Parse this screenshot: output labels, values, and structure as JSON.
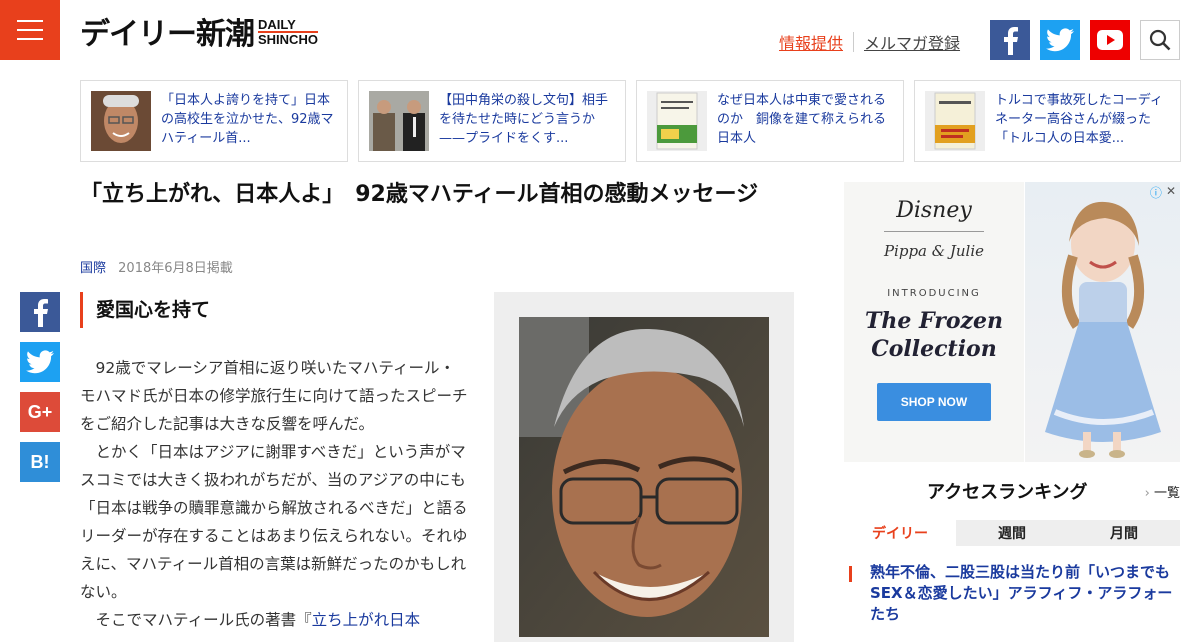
{
  "header": {
    "logo_jp": "デイリー新潮",
    "logo_en_1": "DAILY",
    "logo_en_2": "SHINCHO",
    "link_info": "情報提供",
    "link_mail": "メルマガ登録",
    "accent": "#e8401c"
  },
  "related": [
    {
      "text": "「日本人よ誇りを持て」日本の高校生を泣かせた、92歳マハティール首..."
    },
    {
      "text": "【田中角栄の殺し文句】相手を待たせた時にどう言うか——プライドをくす..."
    },
    {
      "text": "なぜ日本人は中東で愛されるのか　銅像を建て称えられる日本人"
    },
    {
      "text": "トルコで事故死したコーディネーター高谷さんが綴った「トルコ人の日本愛..."
    }
  ],
  "article": {
    "title": "「立ち上がれ、日本人よ」　92歳マハティール首相の感動メッセージ",
    "category": "国際",
    "date": "2018年6月8日掲載",
    "subheading": "愛国心を持て",
    "para1": "92歳でマレーシア首相に返り咲いたマハティール・モハマド氏が日本の修学旅行生に向けて語ったスピーチをご紹介した記事は大きな反響を呼んだ。",
    "para2": "とかく「日本はアジアに謝罪すべきだ」という声がマスコミでは大きく扱われがちだが、当のアジアの中にも「日本は戦争の贖罪意識から解放されるべきだ」と語るリーダーが存在することはあまり伝えられない。それゆえに、マハティール首相の言葉は新鮮だったのかもしれない。",
    "para3_pre": "そこでマハティール氏の著書『",
    "para3_link": "立ち上がれ日本"
  },
  "share": {
    "gplus": "G+",
    "hatena": "B!"
  },
  "ad": {
    "brand": "Disney",
    "sub_brand": "Pippa & Julie",
    "intro": "INTRODUCING",
    "line1": "The Frozen",
    "line2": "Collection",
    "cta": "SHOP NOW",
    "info_icon": "ⓘ",
    "close_icon": "✕"
  },
  "ranking": {
    "title": "アクセスランキング",
    "all_link": "一覧",
    "tabs": [
      "デイリー",
      "週間",
      "月間"
    ],
    "active_tab": 0,
    "first_item": "熟年不倫、二股三股は当たり前「いつまでもSEX＆恋愛したい」アラフィフ・アラフォーたち"
  }
}
